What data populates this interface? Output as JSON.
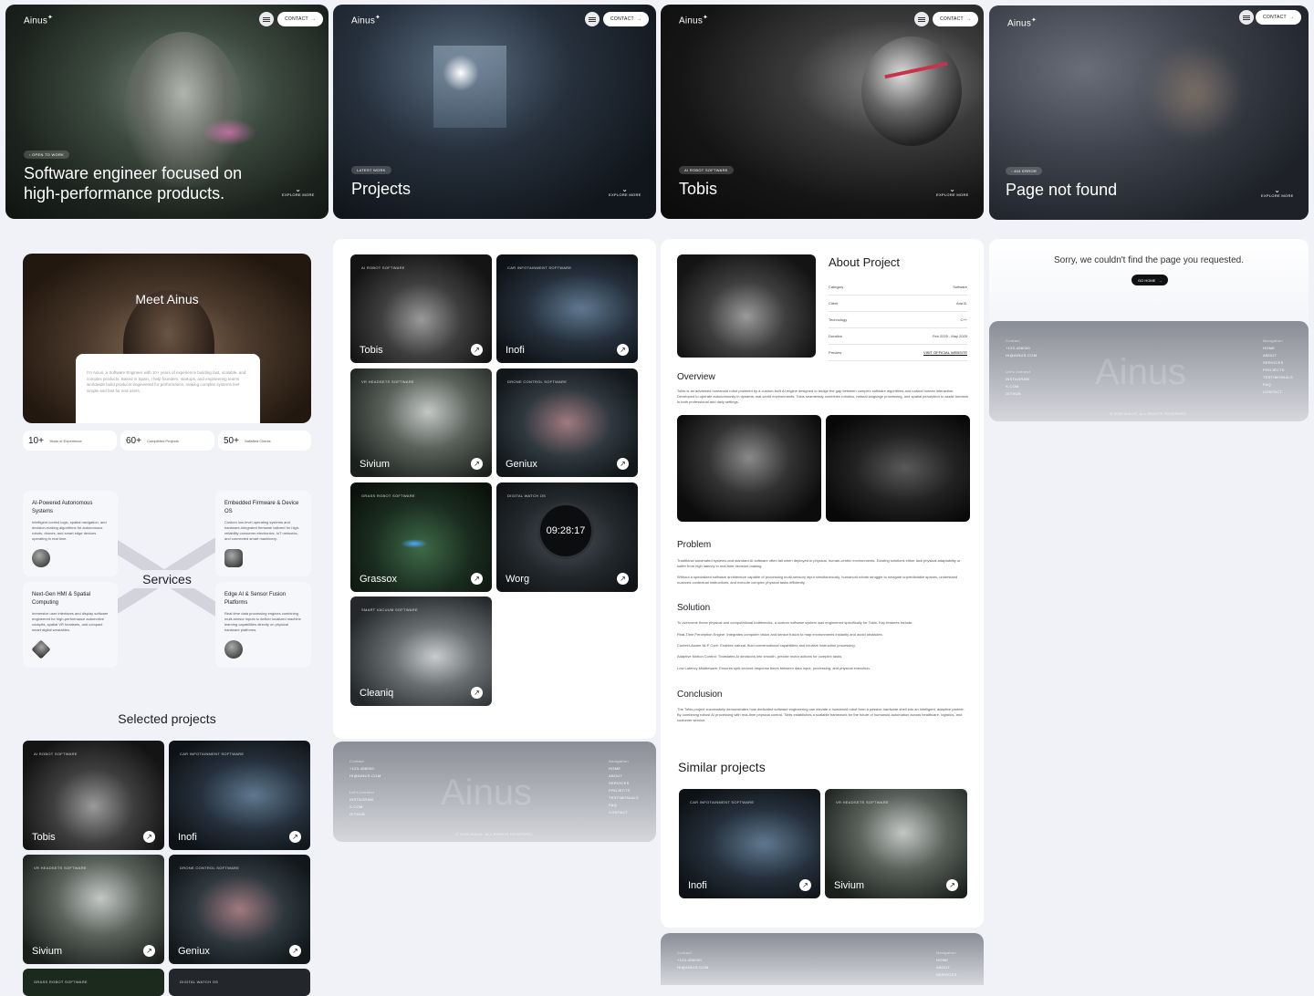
{
  "brand": "Ainus",
  "brand_mark": "✦",
  "nav": {
    "contact": "CONTACT"
  },
  "explore": "EXPLORE MORE",
  "heroes": [
    {
      "tag": "OPEN TO WORK",
      "title": "Software engineer focused on high-performance products."
    },
    {
      "tag": "LATEST WORK",
      "title": "Projects"
    },
    {
      "tag": "AI ROBOT SOFTWARE",
      "title": "Tobis"
    },
    {
      "tag": "404 ERROR",
      "title": "Page not found"
    }
  ],
  "about": {
    "heading": "Meet Ainus",
    "bio": "I'm Ainus, a Software Engineer with 10+ years of experience building fast, scalable, and complex products. Based in Spain, I help founders, startups, and engineering teams worldwide build products engineered for performance, making complex systems feel simple and fast for end users.",
    "stats": [
      {
        "value": "10+",
        "label": "Years of Experience"
      },
      {
        "value": "60+",
        "label": "Completed Projects"
      },
      {
        "value": "50+",
        "label": "Satisfied Clients"
      }
    ]
  },
  "services": {
    "title": "Services",
    "items": [
      {
        "title": "AI-Powered Autonomous Systems",
        "desc": "Intelligent control logic, spatial navigation, and decision-making algorithms for autonomous robots, drones, and smart edge devices operating in real time."
      },
      {
        "title": "Embedded Firmware & Device OS",
        "desc": "Custom low-level operating systems and hardware-integrated firmware tailored for high-reliability consumer electronics, IoT networks, and connected smart machinery."
      },
      {
        "title": "Next-Gen HMI & Spatial Computing",
        "desc": "Immersive user interfaces and display software engineered for high-performance automotive cockpits, spatial VR headsets, and compact smart digital wearables."
      },
      {
        "title": "Edge AI & Sensor Fusion Platforms",
        "desc": "Real-time data processing engines combining multi-sensor inputs to deliver localized machine learning capabilities directly on physical hardware platforms."
      }
    ]
  },
  "selected_title": "Selected projects",
  "projects": [
    {
      "tag": "AI ROBOT SOFTWARE",
      "name": "Tobis"
    },
    {
      "tag": "CAR INFOTAINMENT SOFTWARE",
      "name": "Inofi"
    },
    {
      "tag": "VR HEADSETS SOFTWARE",
      "name": "Sivium"
    },
    {
      "tag": "DRONE CONTROL SOFTWARE",
      "name": "Geniux"
    },
    {
      "tag": "GRASS ROBOT SOFTWARE",
      "name": "Grassox"
    },
    {
      "tag": "DIGITAL WATCH OS",
      "name": "Worg"
    },
    {
      "tag": "SMART VACUUM SOFTWARE",
      "name": "Cleaniq"
    }
  ],
  "detail": {
    "heading": "About Project",
    "rows": [
      {
        "k": "Category",
        "v": "Software"
      },
      {
        "k": "Client",
        "v": "Arla B."
      },
      {
        "k": "Technology",
        "v": "C++"
      },
      {
        "k": "Duration",
        "v": "Feb 2025 - May 2025"
      },
      {
        "k": "Preview",
        "v": "VISIT OFFICIAL WEBSITE"
      }
    ],
    "overview_h": "Overview",
    "overview": "Tobis is an advanced humanoid robot powered by a custom-built AI engine designed to bridge the gap between complex software algorithms and natural human interaction. Developed to operate autonomously in dynamic real-world environments, Tobis seamlessly combines robotics, natural language processing, and spatial perception to assist humans in both professional and daily settings.",
    "problem_h": "Problem",
    "problem1": "Traditional automated systems and standard AI software often fail when deployed in physical, human-centric environments. Existing solutions either lack physical adaptability or suffer from high latency in real-time decision-making.",
    "problem2": "Without a specialized software architecture capable of processing multi-sensory input simultaneously, humanoid robots struggle to navigate unpredictable spaces, understand nuanced contextual instructions, and execute complex physical tasks efficiently.",
    "solution_h": "Solution",
    "solution": "To overcome these physical and computational bottlenecks, a custom software system was engineered specifically for Tobis. Key features include:",
    "features": [
      "Real-Time Perception Engine: Integrates computer vision and sensor fusion to map environments instantly and avoid obstacles.",
      "Context-Aware NLP Core: Enables natural, fluid conversational capabilities and intuitive instruction processing.",
      "Adaptive Motion Control: Translates AI decisions into smooth, precise motor actions for complex tasks.",
      "Low Latency Middleware: Ensures split-second response times between data input, processing, and physical execution."
    ],
    "conclusion_h": "Conclusion",
    "conclusion": "The Tobis project successfully demonstrates how dedicated software engineering can elevate a humanoid robot from a passive hardware shell into an intelligent, adaptive partner. By combining robust AI processing with real-time physical control, Tobis establishes a scalable framework for the future of humanoid automation across healthcare, logistics, and customer service.",
    "similar_h": "Similar projects"
  },
  "notfound": {
    "message": "Sorry, we couldn't find the page you requested.",
    "button": "GO HOME"
  },
  "footer": {
    "contact_h": "Contact",
    "phone": "+123-456000",
    "email": "HI@AINUS.COM",
    "follow_h": "Let's connect",
    "socials": [
      "INSTAGRAM",
      "X.COM",
      "GITHUB"
    ],
    "nav_h": "Navigation",
    "links": [
      "HOME",
      "ABOUT",
      "SERVICES",
      "PROJECTS",
      "TESTIMONIALS",
      "FAQ",
      "CONTACT"
    ],
    "copyright": "© 2025 AINUS. ALL RIGHTS RESERVED."
  },
  "colors": {
    "bg": "#f1f2f7",
    "accent": "#2b6cf0"
  }
}
